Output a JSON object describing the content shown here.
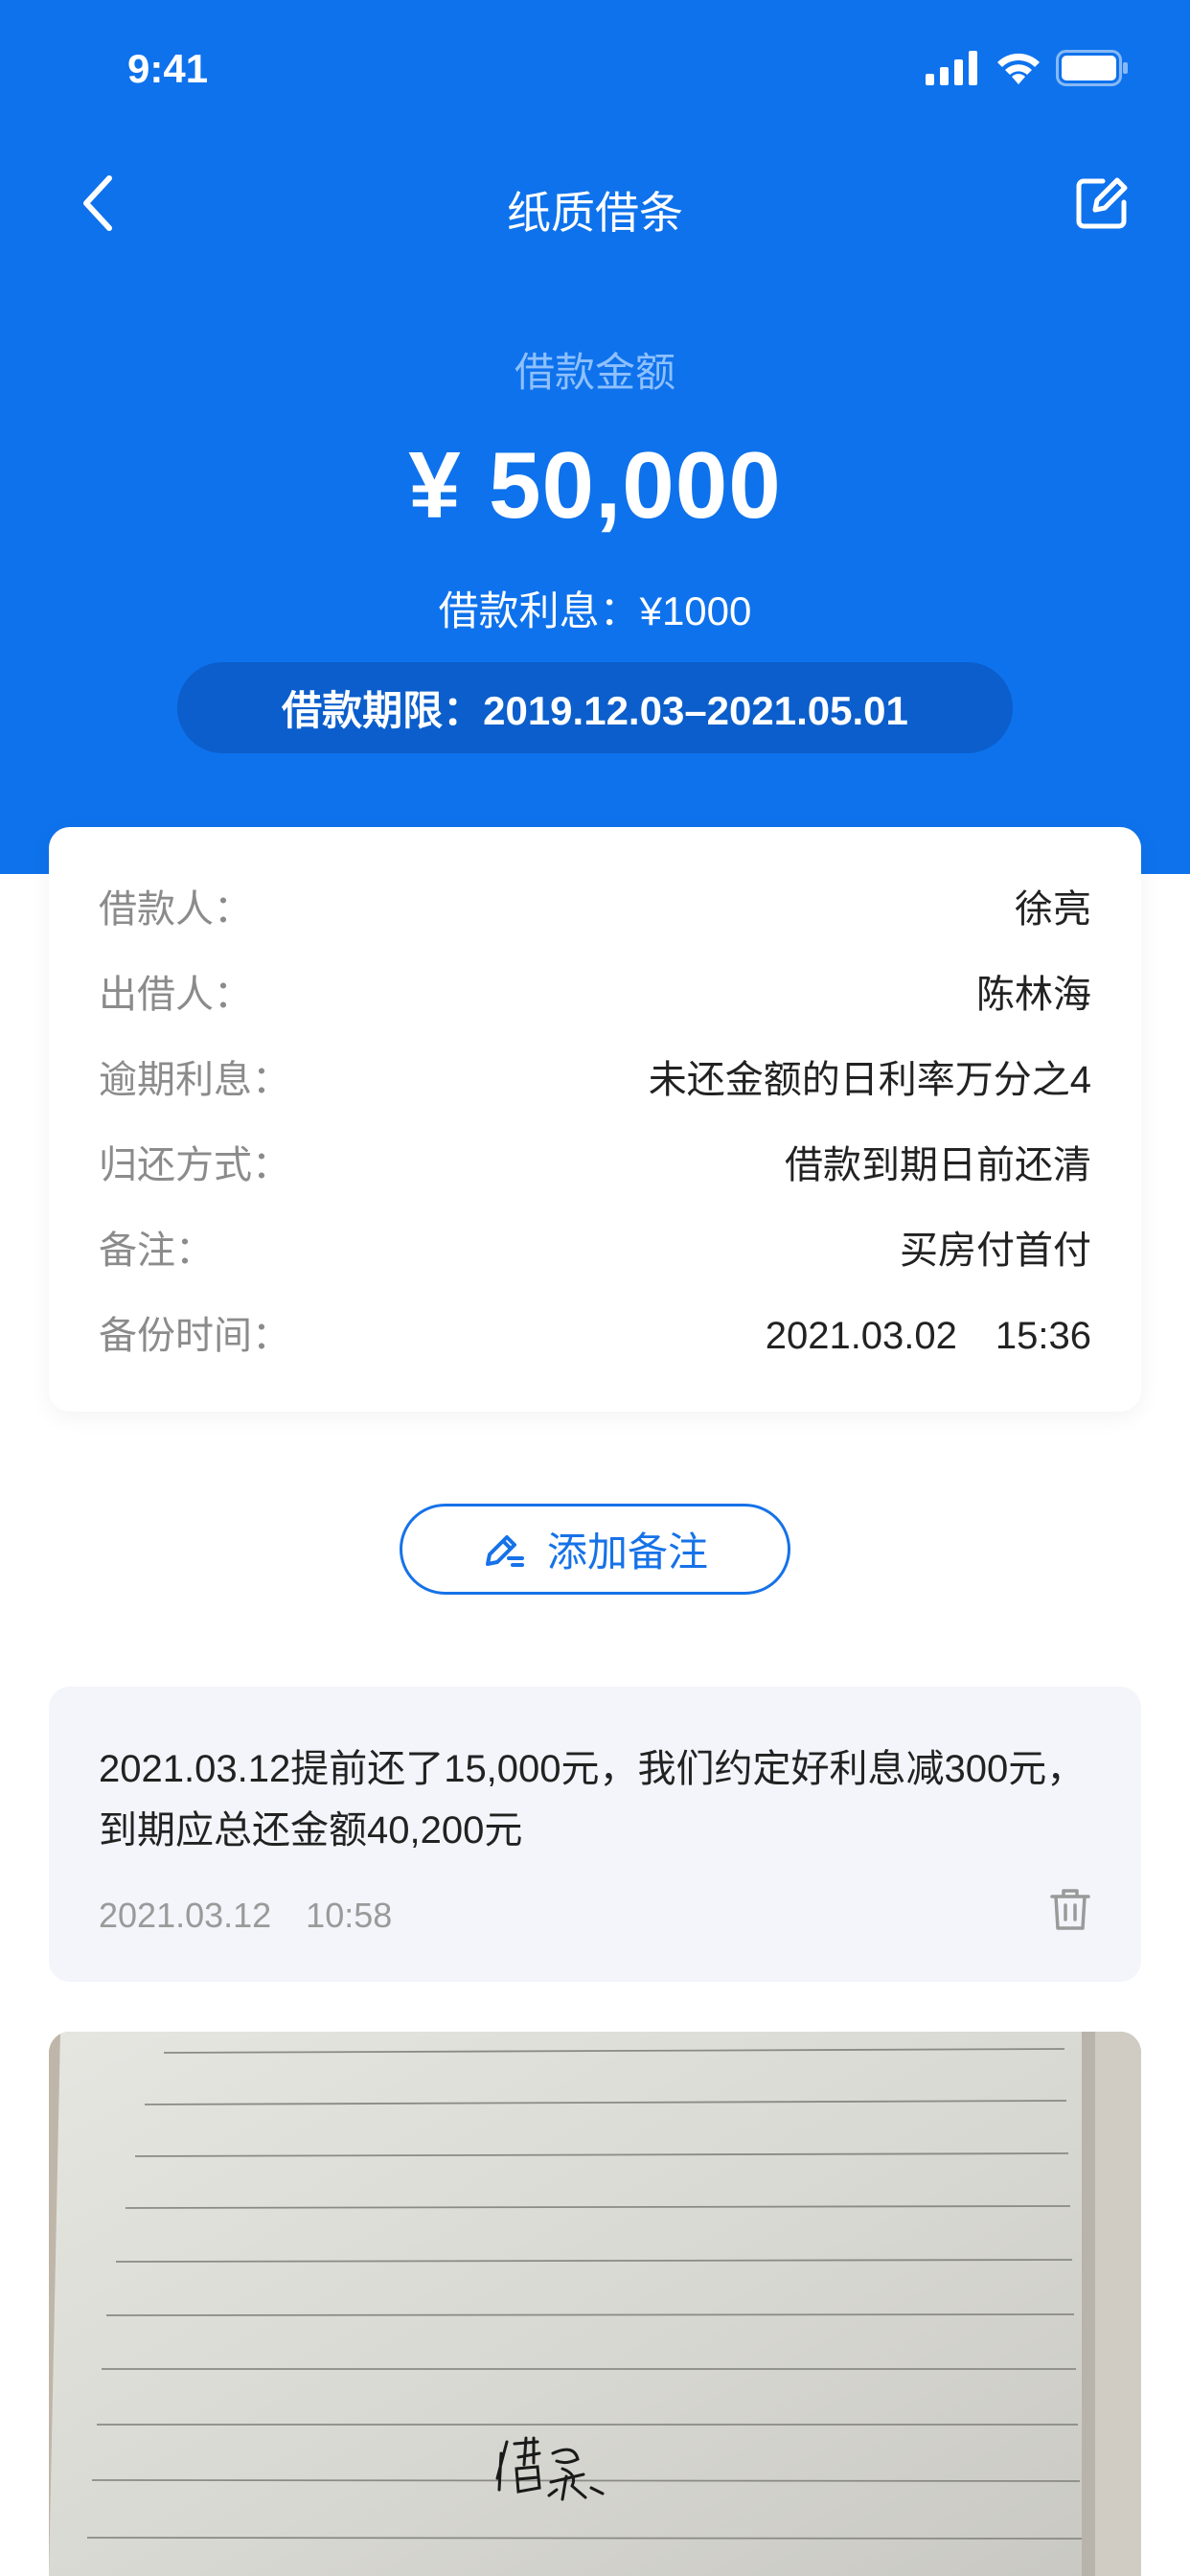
{
  "status_bar": {
    "time": "9:41"
  },
  "nav": {
    "title": "纸质借条"
  },
  "loan": {
    "amount_label": "借款金额",
    "amount": "¥ 50,000",
    "interest": "借款利息：¥1000",
    "term": "借款期限：2019.12.03–2021.05.01"
  },
  "details": [
    {
      "label": "借款人：",
      "value": "徐亮"
    },
    {
      "label": "出借人：",
      "value": "陈林海"
    },
    {
      "label": "逾期利息：",
      "value": "未还金额的日利率万分之4"
    },
    {
      "label": "归还方式：",
      "value": "借款到期日前还清"
    },
    {
      "label": "备注：",
      "value": "买房付首付"
    },
    {
      "label": "备份时间：",
      "value": "2021.03.02　15:36"
    }
  ],
  "add_note_label": "添加备注",
  "note": {
    "text": "2021.03.12提前还了15,000元，我们约定好利息减300元，到期应总还金额40,200元",
    "time": "2021.03.12　10:58"
  },
  "photo": {
    "handwriting": "借条"
  },
  "colors": {
    "primary": "#0e72ec",
    "pill": "#0b5ecb",
    "note_bg": "#f4f5fa",
    "accent": "#1672e8"
  }
}
